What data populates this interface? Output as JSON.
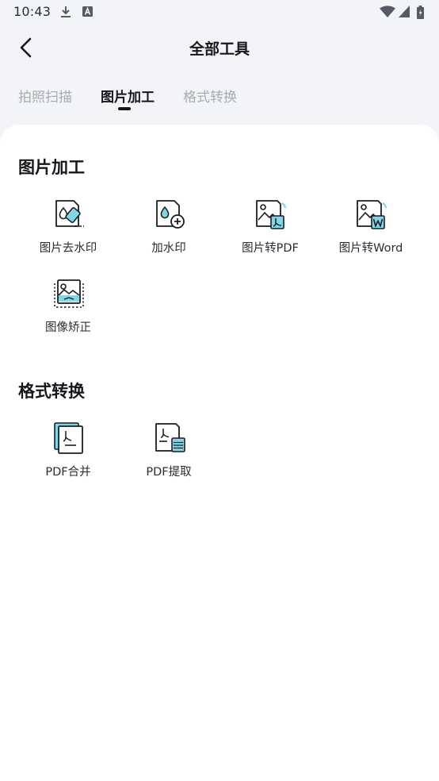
{
  "status_bar": {
    "time": "10:43"
  },
  "header": {
    "title": "全部工具"
  },
  "tabs": [
    {
      "label": "拍照扫描",
      "active": false
    },
    {
      "label": "图片加工",
      "active": true
    },
    {
      "label": "格式转换",
      "active": false
    }
  ],
  "sections": [
    {
      "title": "图片加工",
      "tools": [
        {
          "label": "图片去水印",
          "icon": "watermark-eraser-icon"
        },
        {
          "label": "加水印",
          "icon": "add-watermark-icon"
        },
        {
          "label": "图片转PDF",
          "icon": "image-to-pdf-icon"
        },
        {
          "label": "图片转Word",
          "icon": "image-to-word-icon"
        },
        {
          "label": "图像矫正",
          "icon": "image-correction-icon"
        }
      ]
    },
    {
      "title": "格式转换",
      "tools": [
        {
          "label": "PDF合并",
          "icon": "pdf-merge-icon"
        },
        {
          "label": "PDF提取",
          "icon": "pdf-extract-icon"
        }
      ]
    }
  ],
  "colors": {
    "accent": "#7fd8e8",
    "line": "#1b1d22",
    "page_bg": "#f2f4f7",
    "tab_inactive": "#a7acb6"
  }
}
